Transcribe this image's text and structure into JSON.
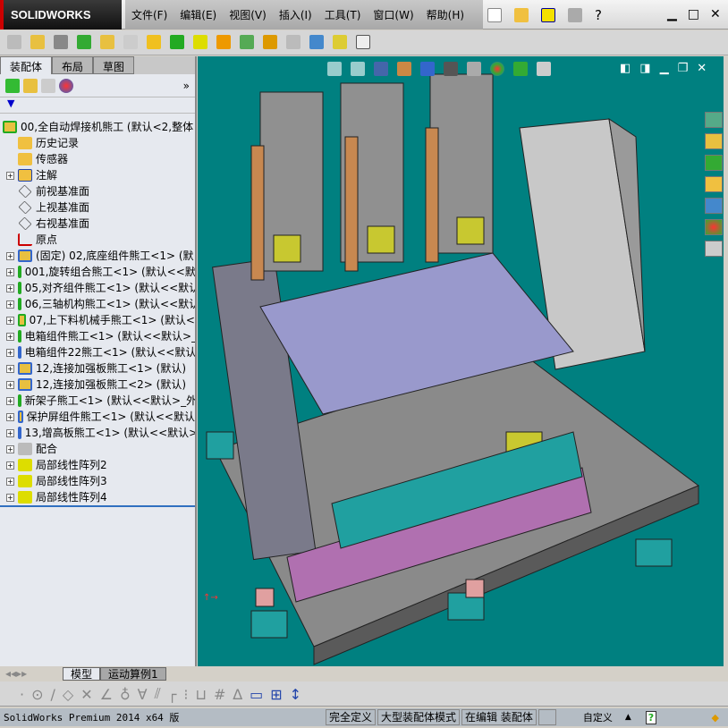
{
  "app": {
    "logo": "SOLIDWORKS"
  },
  "menu": [
    "文件(F)",
    "编辑(E)",
    "视图(V)",
    "插入(I)",
    "工具(T)",
    "窗口(W)",
    "帮助(H)"
  ],
  "left_panel": {
    "tabs": [
      "装配体",
      "布局",
      "草图"
    ],
    "tree": [
      {
        "label": "00,全自动焊接机熊工   (默认<2,整体",
        "icon": "assembly",
        "expand": false
      },
      {
        "label": "历史记录",
        "icon": "history",
        "expand": false
      },
      {
        "label": "传感器",
        "icon": "sensor",
        "expand": false
      },
      {
        "label": "注解",
        "icon": "annotation",
        "expand": true
      },
      {
        "label": "前视基准面",
        "icon": "plane",
        "expand": false
      },
      {
        "label": "上视基准面",
        "icon": "plane",
        "expand": false
      },
      {
        "label": "右视基准面",
        "icon": "plane",
        "expand": false
      },
      {
        "label": "原点",
        "icon": "origin",
        "expand": false
      },
      {
        "label": "(固定) 02,底座组件熊工<1> (默",
        "icon": "subassembly-edit",
        "expand": true
      },
      {
        "label": "001,旋转组合熊工<1> (默认<<默",
        "icon": "assembly",
        "expand": true
      },
      {
        "label": "05,对齐组件熊工<1> (默认<<默认",
        "icon": "assembly",
        "expand": true
      },
      {
        "label": "06,三轴机构熊工<1> (默认<<默认",
        "icon": "assembly",
        "expand": true
      },
      {
        "label": "07,上下料机械手熊工<1> (默认<",
        "icon": "assembly",
        "expand": true
      },
      {
        "label": "电箱组件熊工<1> (默认<<默认>_",
        "icon": "assembly",
        "expand": true
      },
      {
        "label": "电箱组件22熊工<1> (默认<<默认",
        "icon": "subassembly-light",
        "expand": true
      },
      {
        "label": "12,连接加强板熊工<1> (默认)",
        "icon": "subassembly-edit",
        "expand": true
      },
      {
        "label": "12,连接加强板熊工<2> (默认)",
        "icon": "subassembly-edit",
        "expand": true
      },
      {
        "label": "新架子熊工<1> (默认<<默认>_外",
        "icon": "assembly",
        "expand": true
      },
      {
        "label": "保护屏组件熊工<1> (默认<<默认",
        "icon": "subassembly-edit",
        "expand": true
      },
      {
        "label": "13,增高板熊工<1> (默认<<默认>",
        "icon": "subassembly-edit",
        "expand": true
      },
      {
        "label": "配合",
        "icon": "mates",
        "expand": true
      },
      {
        "label": "局部线性阵列2",
        "icon": "pattern",
        "expand": true
      },
      {
        "label": "局部线性阵列3",
        "icon": "pattern",
        "expand": true
      },
      {
        "label": "局部线性阵列4",
        "icon": "pattern",
        "expand": true
      }
    ]
  },
  "bottom_tabs": [
    "模型",
    "运动算例1"
  ],
  "status": {
    "product": "SolidWorks Premium 2014 x64 版",
    "state": "完全定义",
    "mode": "大型装配体模式",
    "editing": "在编辑 装配体",
    "units": "自定义"
  },
  "colors": {
    "viewport_bg": "#008080",
    "accent": "#3070c0"
  }
}
